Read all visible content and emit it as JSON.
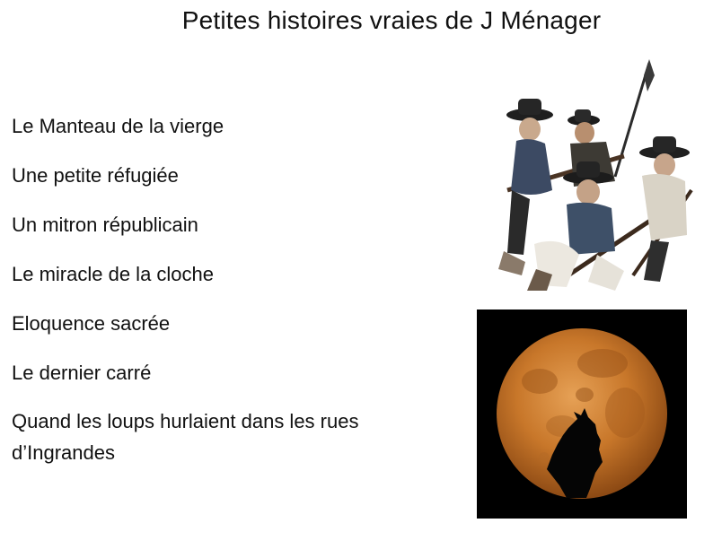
{
  "page": {
    "title": "Petites histoires vraies de J Ménager"
  },
  "stories": [
    "Le Manteau de la vierge",
    "Une petite réfugiée",
    "Un mitron républicain",
    "Le miracle de la cloche",
    "Eloquence sacrée",
    "Le dernier carré",
    "Quand les loups hurlaient dans les rues d’Ingrandes"
  ],
  "illustrations": {
    "soldiers": "armed-peasant-soldiers-illustration",
    "moon": "wolf-howling-at-full-moon-illustration"
  },
  "colors": {
    "text": "#111111",
    "background": "#ffffff",
    "moon": "#c8772a",
    "sky": "#000000"
  }
}
